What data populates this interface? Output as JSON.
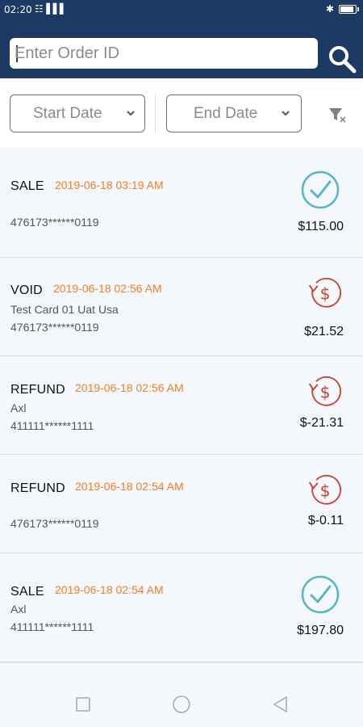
{
  "status_bar": {
    "time": "02:20",
    "left_indicator": "☷▐▐▐",
    "bluetooth": "✱"
  },
  "search": {
    "placeholder": "Enter Order ID",
    "value": ""
  },
  "filters": {
    "start_label": "Start Date",
    "end_label": "End Date"
  },
  "colors": {
    "header_bg": "#1c3a63",
    "date_text": "#f07f23",
    "success_teal": "#55b7c4",
    "refund_red": "#c8412f"
  },
  "transactions": [
    {
      "type": "SALE",
      "datetime": "2019-06-18 03:19 AM",
      "sub": "",
      "card": "476173******0119",
      "amount": "$115.00",
      "icon": "check-circle-icon"
    },
    {
      "type": "VOID",
      "datetime": "2019-06-18 02:56 AM",
      "sub": "Test Card 01 Uat Usa",
      "card": "476173******0119",
      "amount": "$21.52",
      "icon": "refund-dollar-icon"
    },
    {
      "type": "REFUND",
      "datetime": "2019-06-18 02:56 AM",
      "sub": "Axl",
      "card": "411111******1111",
      "amount": "$-21.31",
      "icon": "refund-dollar-icon"
    },
    {
      "type": "REFUND",
      "datetime": "2019-06-18 02:54 AM",
      "sub": "",
      "card": "476173******0119",
      "amount": "$-0.11",
      "icon": "refund-dollar-icon"
    },
    {
      "type": "SALE",
      "datetime": "2019-06-18 02:54 AM",
      "sub": "Axl",
      "card": "411111******1111",
      "amount": "$197.80",
      "icon": "check-circle-icon"
    }
  ]
}
